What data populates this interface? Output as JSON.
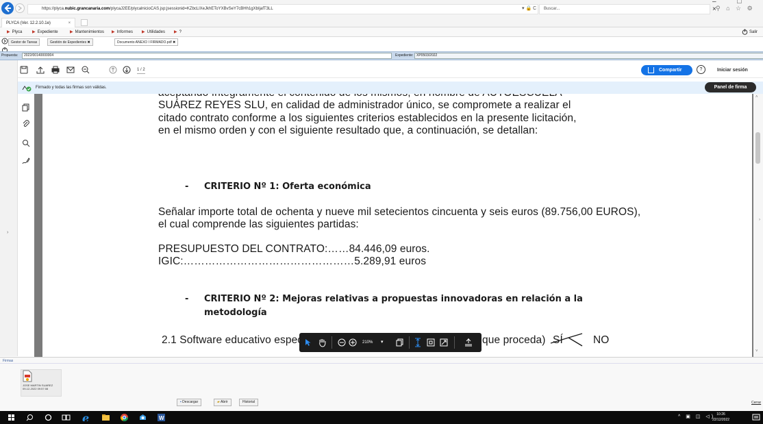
{
  "browser": {
    "url_prefix": "https://plyca.",
    "url_host": "nubic.grancanaria.com",
    "url_path": "/plycaJ2EE/plycalnicioCAS.jsp;jsessionid=KZbcLlXeJkhEToYXBvSeY7cBHh1gXbIjafT3LL",
    "addr_controls": "▾ 🔒 C",
    "search_placeholder": "Buscar...",
    "tab_title": "PLYCA (Ver. 12.2.10.1e)",
    "tab_close": "×",
    "window_controls": "– □ ×"
  },
  "menu": {
    "items": [
      {
        "label": "Plyca"
      },
      {
        "label": "Expediente"
      },
      {
        "label": "Mantenimientos"
      },
      {
        "label": "Informes"
      },
      {
        "label": "Utilidades"
      },
      {
        "label": "?"
      }
    ],
    "exit_label": "Salir"
  },
  "app_tabs": [
    {
      "label": "Gestor de Tareas"
    },
    {
      "label": "Gestión de Expedientes ✖"
    },
    {
      "label": "Documento ANEXO I FIRMADO.pdf ✖"
    }
  ],
  "proposal": {
    "label": "Propuesta:",
    "value": "2022/00140000004",
    "exp_label": "Expediente:",
    "exp_value": "XP0503/2022"
  },
  "pdf_toolbar": {
    "page_indicator": "1  / 2",
    "share_label": "Compartir",
    "help_label": "?",
    "login_label": "Iniciar sesión"
  },
  "signature_bar": {
    "status": "Firmado y todas las firmas son válidas.",
    "panel_button": "Panel de firma"
  },
  "document": {
    "lines": [
      "aceptando   íntegramente   el contenido   de  los  mismos,   en  nombre de AUTOESCUELA",
      "SUÁREZ REYES SLU, en calidad de administrador único,  se  compromete a realizar el",
      "citado  contrato  conforme  a los  siguientes  criterios  establecidos  en la  presente licitación,",
      "en el mismo orden  y con el siguiente  resultado  que, a continuación, se detallan:"
    ],
    "criterion1_bullet": "-",
    "criterion1": "CRITERIO Nº 1: Oferta económica",
    "offer_line1": "Señalar  importe  total   de ochenta y nueve mil setecientos cincuenta y seis euros (89.756,00 EUROS),",
    "offer_line2": "el cual comprende las siguientes  partidas:",
    "budget_line": "PRESUPUESTO DEL CONTRATO:……84.446,09 euros.",
    "igic_line": "IGIC:…………………………………………5.289,91 euros",
    "criterion2_bullet": "-",
    "criterion2_line1": "CRITERIO Nº 2: Mejoras relativas a propuestas innovadoras en relación a la",
    "criterion2_line2": "metodología",
    "item21_start": "2.1 Software educativo espec",
    "item21_end": "que proceda)",
    "item21_si": "SÍ",
    "item21_no": "NO"
  },
  "float_toolbar": {
    "zoom": "210%",
    "zoom_caret": "▾"
  },
  "firmas": {
    "label": "Firmas",
    "signer": "JOSE MARTIN SUAREZ",
    "date": "09-12-2022 09:57:08",
    "download": "Descargar",
    "open": "Abrir",
    "history": "Historial",
    "close": "Cerrar"
  },
  "taskbar": {
    "time": "10:26",
    "date": "22/12/2022"
  }
}
